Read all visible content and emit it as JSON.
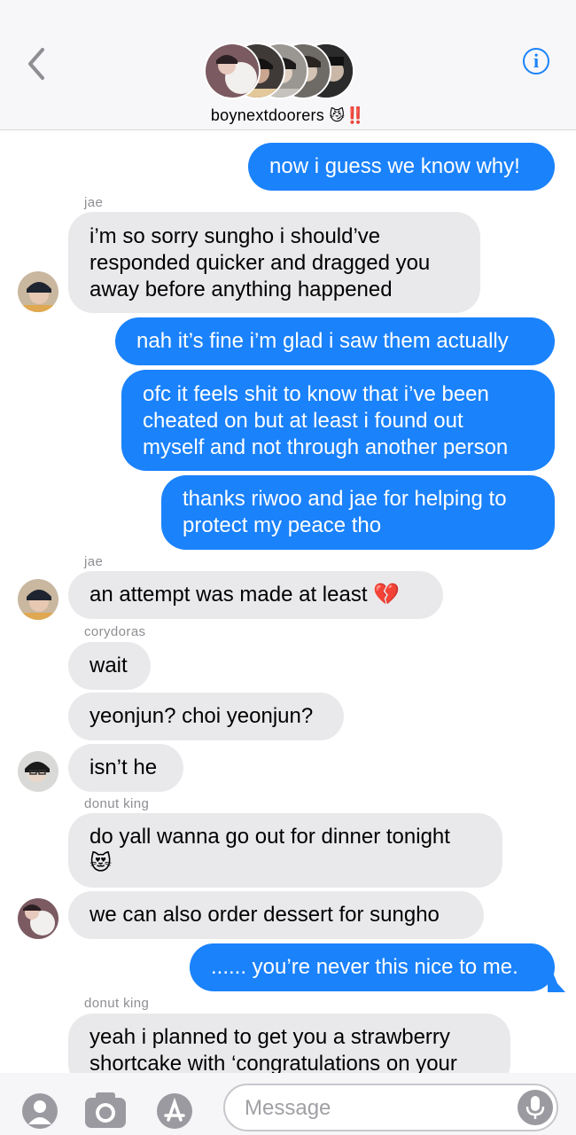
{
  "header": {
    "group_name": "boynextdoorers",
    "group_emoji": "😼",
    "group_suffix": "‼️",
    "back_icon": "chevron-left-icon",
    "info_icon": "info-icon",
    "info_label": "i"
  },
  "colors": {
    "outgoing": "#1a82fb",
    "incoming": "#e9e9eb",
    "sender_label": "#8e8e93",
    "accent": "#1a82fb"
  },
  "messages": {
    "m1": "now i guess we know why!",
    "s_jae_1": "jae",
    "m2_l1": "i’m so sorry sungho i should’ve",
    "m2_l2": "responded quicker and dragged you",
    "m2_l3": "away before anything happened",
    "m3": "nah it’s fine i’m glad i saw them actually",
    "m4_l1": "ofc it feels shit to know that i’ve been",
    "m4_l2": "cheated on but at least i found out",
    "m4_l3": "myself and not through another person",
    "m5_l1": "thanks riwoo and jae for helping to",
    "m5_l2": "protect my peace tho",
    "s_jae_2": "jae",
    "m6": "an attempt was made at least 💔",
    "s_cory": "corydoras",
    "m7": "wait",
    "m8": "yeonjun? choi yeonjun?",
    "m9": "isn’t he",
    "s_donut_1": "donut king",
    "m10_l1": "do yall wanna go out for dinner tonight",
    "m10_l2": "😻",
    "m11": "we can also order dessert for sungho",
    "m12": "...... you’re never this nice to me.",
    "s_donut_2": "donut king",
    "m13_l1": "yeah i planned to get you a strawberry",
    "m13_l2": "shortcake with ‘congratulations on your"
  },
  "composer": {
    "placeholder": "Message",
    "icons": [
      "memoji-icon",
      "camera-icon",
      "app-store-icon",
      "microphone-icon"
    ]
  }
}
